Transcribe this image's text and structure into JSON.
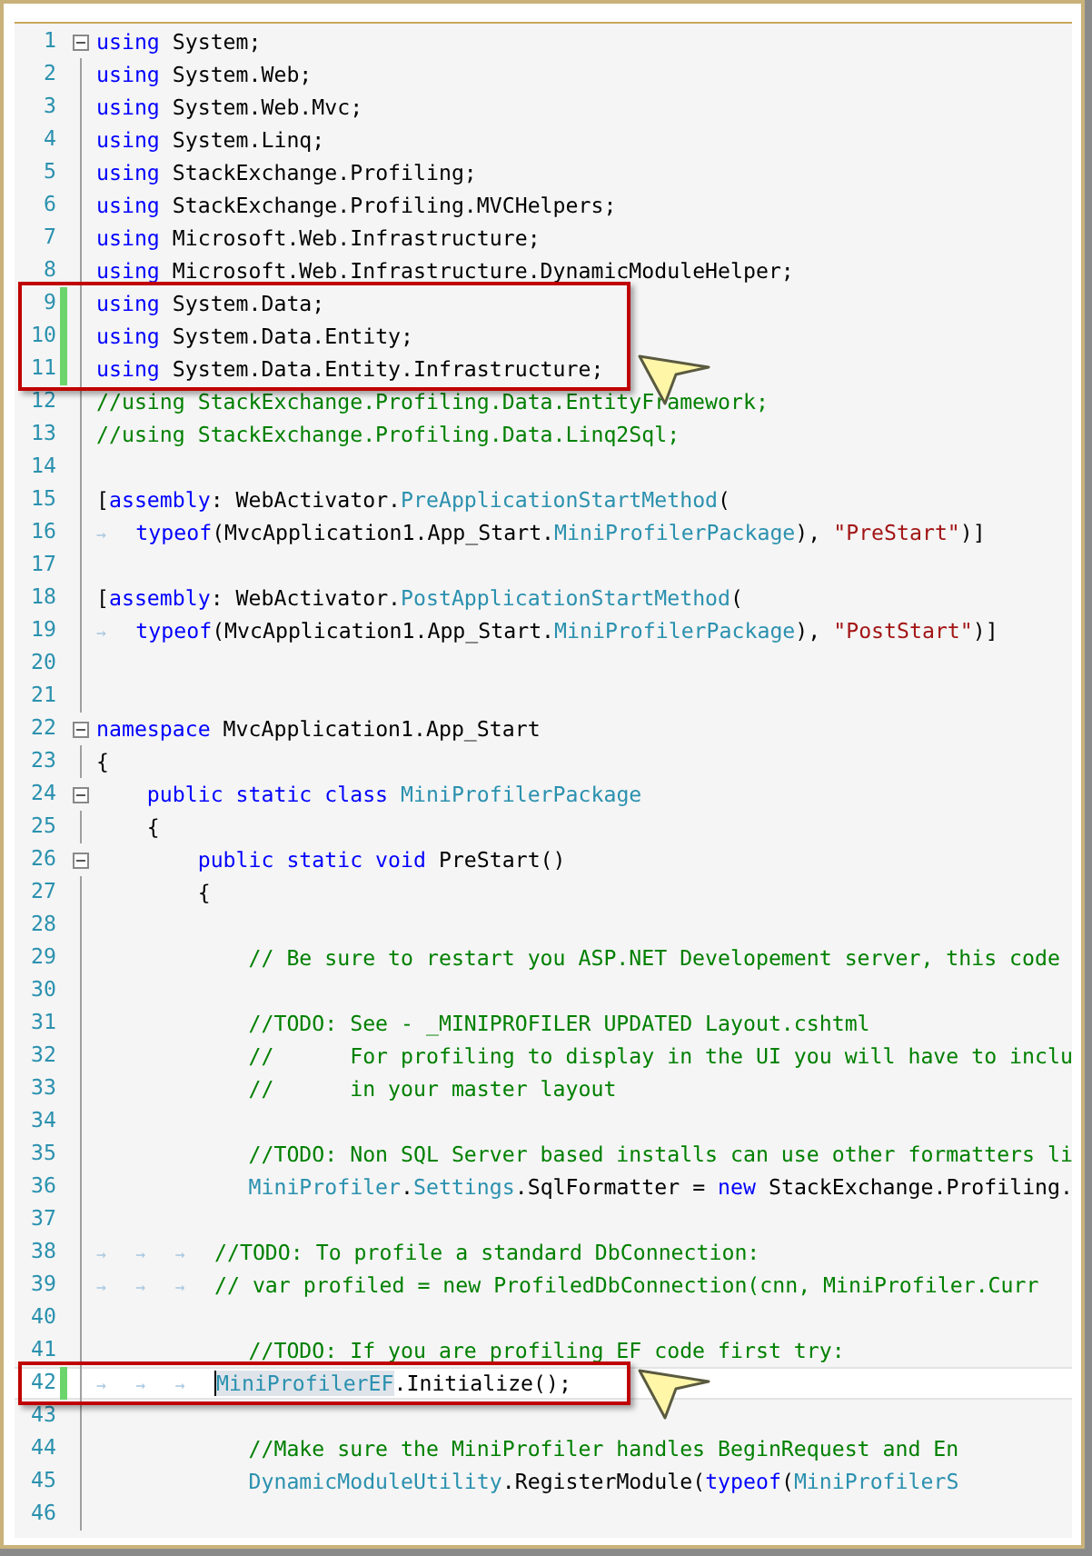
{
  "editor": {
    "lines": [
      {
        "number": "1",
        "changed": false,
        "fold": true,
        "boxed": false,
        "current": false,
        "tokens": [
          {
            "kind": "keyword",
            "text": "using"
          },
          {
            "kind": "plain",
            "text": " System;"
          }
        ]
      },
      {
        "number": "2",
        "changed": false,
        "fold": false,
        "boxed": false,
        "current": false,
        "tokens": [
          {
            "kind": "keyword",
            "text": "using"
          },
          {
            "kind": "plain",
            "text": " System.Web;"
          }
        ]
      },
      {
        "number": "3",
        "changed": false,
        "fold": false,
        "boxed": false,
        "current": false,
        "tokens": [
          {
            "kind": "keyword",
            "text": "using"
          },
          {
            "kind": "plain",
            "text": " System.Web.Mvc;"
          }
        ]
      },
      {
        "number": "4",
        "changed": false,
        "fold": false,
        "boxed": false,
        "current": false,
        "tokens": [
          {
            "kind": "keyword",
            "text": "using"
          },
          {
            "kind": "plain",
            "text": " System.Linq;"
          }
        ]
      },
      {
        "number": "5",
        "changed": false,
        "fold": false,
        "boxed": false,
        "current": false,
        "tokens": [
          {
            "kind": "keyword",
            "text": "using"
          },
          {
            "kind": "plain",
            "text": " StackExchange.Profiling;"
          }
        ]
      },
      {
        "number": "6",
        "changed": false,
        "fold": false,
        "boxed": false,
        "current": false,
        "tokens": [
          {
            "kind": "keyword",
            "text": "using"
          },
          {
            "kind": "plain",
            "text": " StackExchange.Profiling.MVCHelpers;"
          }
        ]
      },
      {
        "number": "7",
        "changed": false,
        "fold": false,
        "boxed": false,
        "current": false,
        "tokens": [
          {
            "kind": "keyword",
            "text": "using"
          },
          {
            "kind": "plain",
            "text": " Microsoft.Web.Infrastructure;"
          }
        ]
      },
      {
        "number": "8",
        "changed": false,
        "fold": false,
        "boxed": false,
        "current": false,
        "tokens": [
          {
            "kind": "keyword",
            "text": "using"
          },
          {
            "kind": "plain",
            "text": " Microsoft.Web.Infrastructure.DynamicModuleHelper;"
          }
        ]
      },
      {
        "number": "9",
        "changed": true,
        "fold": false,
        "boxed": true,
        "current": false,
        "tokens": [
          {
            "kind": "keyword",
            "text": "using"
          },
          {
            "kind": "plain",
            "text": " System.Data;"
          }
        ]
      },
      {
        "number": "10",
        "changed": true,
        "fold": false,
        "boxed": true,
        "current": false,
        "tokens": [
          {
            "kind": "keyword",
            "text": "using"
          },
          {
            "kind": "plain",
            "text": " System.Data.Entity;"
          }
        ]
      },
      {
        "number": "11",
        "changed": true,
        "fold": false,
        "boxed": true,
        "current": false,
        "tokens": [
          {
            "kind": "keyword",
            "text": "using"
          },
          {
            "kind": "plain",
            "text": " System.Data.Entity.Infrastructure;"
          }
        ]
      },
      {
        "number": "12",
        "changed": false,
        "fold": false,
        "boxed": false,
        "current": false,
        "tokens": [
          {
            "kind": "comment",
            "text": "//using StackExchange.Profiling.Data.EntityFramework;"
          }
        ]
      },
      {
        "number": "13",
        "changed": false,
        "fold": false,
        "boxed": false,
        "current": false,
        "tokens": [
          {
            "kind": "comment",
            "text": "//using StackExchange.Profiling.Data.Linq2Sql;"
          }
        ]
      },
      {
        "number": "14",
        "changed": false,
        "fold": false,
        "boxed": false,
        "current": false
      },
      {
        "number": "15",
        "changed": false,
        "fold": false,
        "boxed": false,
        "current": false,
        "tokens": [
          {
            "kind": "plain",
            "text": "["
          },
          {
            "kind": "keyword",
            "text": "assembly"
          },
          {
            "kind": "plain",
            "text": ": WebActivator."
          },
          {
            "kind": "type",
            "text": "PreApplicationStartMethod"
          },
          {
            "kind": "plain",
            "text": "("
          }
        ]
      },
      {
        "number": "16",
        "changed": false,
        "fold": false,
        "boxed": false,
        "current": false,
        "tokens": [
          {
            "kind": "tab",
            "text": "→"
          },
          {
            "kind": "keyword",
            "text": "typeof"
          },
          {
            "kind": "plain",
            "text": "(MvcApplication1.App_Start."
          },
          {
            "kind": "type",
            "text": "MiniProfilerPackage"
          },
          {
            "kind": "plain",
            "text": "), "
          },
          {
            "kind": "string",
            "text": "\"PreStart\""
          },
          {
            "kind": "plain",
            "text": ")]"
          }
        ]
      },
      {
        "number": "17",
        "changed": false,
        "fold": false,
        "boxed": false,
        "current": false
      },
      {
        "number": "18",
        "changed": false,
        "fold": false,
        "boxed": false,
        "current": false,
        "tokens": [
          {
            "kind": "plain",
            "text": "["
          },
          {
            "kind": "keyword",
            "text": "assembly"
          },
          {
            "kind": "plain",
            "text": ": WebActivator."
          },
          {
            "kind": "type",
            "text": "PostApplicationStartMethod"
          },
          {
            "kind": "plain",
            "text": "("
          }
        ]
      },
      {
        "number": "19",
        "changed": false,
        "fold": false,
        "boxed": false,
        "current": false,
        "tokens": [
          {
            "kind": "tab",
            "text": "→"
          },
          {
            "kind": "keyword",
            "text": "typeof"
          },
          {
            "kind": "plain",
            "text": "(MvcApplication1.App_Start."
          },
          {
            "kind": "type",
            "text": "MiniProfilerPackage"
          },
          {
            "kind": "plain",
            "text": "), "
          },
          {
            "kind": "string",
            "text": "\"PostStart\""
          },
          {
            "kind": "plain",
            "text": ")]"
          }
        ]
      },
      {
        "number": "20",
        "changed": false,
        "fold": false,
        "boxed": false,
        "current": false
      },
      {
        "number": "21",
        "changed": false,
        "fold": false,
        "boxed": false,
        "current": false
      },
      {
        "number": "22",
        "changed": false,
        "fold": true,
        "boxed": false,
        "current": false,
        "tokens": [
          {
            "kind": "keyword",
            "text": "namespace"
          },
          {
            "kind": "plain",
            "text": " MvcApplication1.App_Start"
          }
        ]
      },
      {
        "number": "23",
        "changed": false,
        "fold": false,
        "boxed": false,
        "current": false,
        "tokens": [
          {
            "kind": "plain",
            "text": "{"
          }
        ]
      },
      {
        "number": "24",
        "changed": false,
        "fold": true,
        "boxed": false,
        "current": false,
        "tokens": [
          {
            "kind": "keyword",
            "text": "    public static class "
          },
          {
            "kind": "type",
            "text": "MiniProfilerPackage"
          }
        ]
      },
      {
        "number": "25",
        "changed": false,
        "fold": false,
        "boxed": false,
        "current": false,
        "tokens": [
          {
            "kind": "plain",
            "text": "    {"
          }
        ]
      },
      {
        "number": "26",
        "changed": false,
        "fold": true,
        "boxed": false,
        "current": false,
        "tokens": [
          {
            "kind": "keyword",
            "text": "        public static void"
          },
          {
            "kind": "plain",
            "text": " PreStart()"
          }
        ]
      },
      {
        "number": "27",
        "changed": false,
        "fold": false,
        "boxed": false,
        "current": false,
        "tokens": [
          {
            "kind": "plain",
            "text": "        {"
          }
        ]
      },
      {
        "number": "28",
        "changed": false,
        "fold": false,
        "boxed": false,
        "current": false
      },
      {
        "number": "29",
        "changed": false,
        "fold": false,
        "boxed": false,
        "current": false,
        "tokens": [
          {
            "kind": "comment",
            "text": "            // Be sure to restart you ASP.NET Developement server, this code"
          }
        ]
      },
      {
        "number": "30",
        "changed": false,
        "fold": false,
        "boxed": false,
        "current": false
      },
      {
        "number": "31",
        "changed": false,
        "fold": false,
        "boxed": false,
        "current": false,
        "tokens": [
          {
            "kind": "comment",
            "text": "            //TODO: See - _MINIPROFILER UPDATED Layout.cshtml"
          }
        ]
      },
      {
        "number": "32",
        "changed": false,
        "fold": false,
        "boxed": false,
        "current": false,
        "tokens": [
          {
            "kind": "comment",
            "text": "            //      For profiling to display in the UI you will have to inclu"
          }
        ]
      },
      {
        "number": "33",
        "changed": false,
        "fold": false,
        "boxed": false,
        "current": false,
        "tokens": [
          {
            "kind": "comment",
            "text": "            //      in your master layout"
          }
        ]
      },
      {
        "number": "34",
        "changed": false,
        "fold": false,
        "boxed": false,
        "current": false
      },
      {
        "number": "35",
        "changed": false,
        "fold": false,
        "boxed": false,
        "current": false,
        "tokens": [
          {
            "kind": "comment",
            "text": "            //TODO: Non SQL Server based installs can use other formatters li"
          }
        ]
      },
      {
        "number": "36",
        "changed": false,
        "fold": false,
        "boxed": false,
        "current": false,
        "tokens": [
          {
            "kind": "type",
            "text": "            MiniProfiler"
          },
          {
            "kind": "plain",
            "text": "."
          },
          {
            "kind": "type",
            "text": "Settings"
          },
          {
            "kind": "plain",
            "text": ".SqlFormatter = "
          },
          {
            "kind": "keyword",
            "text": "new"
          },
          {
            "kind": "plain",
            "text": " StackExchange.Profiling."
          }
        ]
      },
      {
        "number": "37",
        "changed": false,
        "fold": false,
        "boxed": false,
        "current": false
      },
      {
        "number": "38",
        "changed": false,
        "fold": false,
        "boxed": false,
        "current": false,
        "tokens": [
          {
            "kind": "tab",
            "text": "→"
          },
          {
            "kind": "tab",
            "text": "→"
          },
          {
            "kind": "tab",
            "text": "→"
          },
          {
            "kind": "comment",
            "text": "//TODO: To profile a standard DbConnection:"
          }
        ]
      },
      {
        "number": "39",
        "changed": false,
        "fold": false,
        "boxed": false,
        "current": false,
        "tokens": [
          {
            "kind": "tab",
            "text": "→"
          },
          {
            "kind": "tab",
            "text": "→"
          },
          {
            "kind": "tab",
            "text": "→"
          },
          {
            "kind": "comment",
            "text": "// var profiled = new ProfiledDbConnection(cnn, MiniProfiler.Curr"
          }
        ]
      },
      {
        "number": "40",
        "changed": false,
        "fold": false,
        "boxed": false,
        "current": false
      },
      {
        "number": "41",
        "changed": false,
        "fold": false,
        "boxed": false,
        "current": false,
        "tokens": [
          {
            "kind": "comment",
            "text": "            //TODO: If you are profiling EF code first try:"
          }
        ]
      },
      {
        "number": "42",
        "changed": true,
        "fold": false,
        "boxed": true,
        "current": true,
        "tokens": [
          {
            "kind": "tab",
            "text": "→"
          },
          {
            "kind": "tab",
            "text": "→"
          },
          {
            "kind": "tab",
            "text": "→"
          },
          {
            "kind": "type",
            "text": "MiniProfilerEF",
            "highlighted": true
          },
          {
            "kind": "plain",
            "text": ".Initialize();"
          }
        ]
      },
      {
        "number": "43",
        "changed": false,
        "fold": false,
        "boxed": false,
        "current": false
      },
      {
        "number": "44",
        "changed": false,
        "fold": false,
        "boxed": false,
        "current": false,
        "tokens": [
          {
            "kind": "comment",
            "text": "            //Make sure the MiniProfiler handles BeginRequest and En"
          }
        ]
      },
      {
        "number": "45",
        "changed": false,
        "fold": false,
        "boxed": false,
        "current": false,
        "tokens": [
          {
            "kind": "type",
            "text": "            DynamicModuleUtility"
          },
          {
            "kind": "plain",
            "text": ".RegisterModule("
          },
          {
            "kind": "keyword",
            "text": "typeof"
          },
          {
            "kind": "plain",
            "text": "("
          },
          {
            "kind": "type",
            "text": "MiniProfilerS"
          }
        ]
      },
      {
        "number": "46",
        "changed": false,
        "fold": false,
        "boxed": false,
        "current": false
      }
    ]
  }
}
